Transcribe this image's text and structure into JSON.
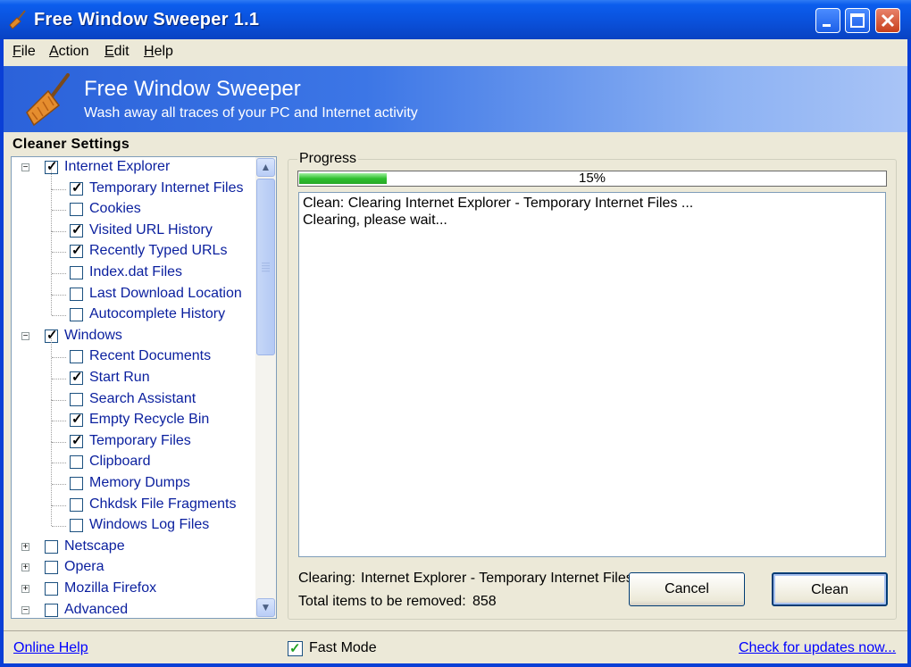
{
  "window": {
    "title": "Free Window Sweeper 1.1"
  },
  "menu": {
    "items": [
      {
        "key": "F",
        "rest": "ile"
      },
      {
        "key": "A",
        "rest": "ction"
      },
      {
        "key": "E",
        "rest": "dit"
      },
      {
        "key": "H",
        "rest": "elp"
      }
    ]
  },
  "banner": {
    "title": "Free Window Sweeper",
    "subtitle": "Wash away all traces of your PC and Internet activity"
  },
  "settings": {
    "label": "Cleaner Settings",
    "tree": [
      {
        "label": "Internet Explorer",
        "checked": true,
        "level": 0,
        "expander": "minus"
      },
      {
        "label": "Temporary Internet Files",
        "checked": true,
        "level": 1
      },
      {
        "label": "Cookies",
        "checked": false,
        "level": 1
      },
      {
        "label": "Visited URL History",
        "checked": true,
        "level": 1
      },
      {
        "label": "Recently Typed URLs",
        "checked": true,
        "level": 1
      },
      {
        "label": "Index.dat Files",
        "checked": false,
        "level": 1
      },
      {
        "label": "Last Download Location",
        "checked": false,
        "level": 1
      },
      {
        "label": "Autocomplete History",
        "checked": false,
        "level": 1
      },
      {
        "label": "Windows",
        "checked": true,
        "level": 0,
        "expander": "minus"
      },
      {
        "label": "Recent Documents",
        "checked": false,
        "level": 1
      },
      {
        "label": "Start Run",
        "checked": true,
        "level": 1
      },
      {
        "label": "Search Assistant",
        "checked": false,
        "level": 1
      },
      {
        "label": "Empty Recycle Bin",
        "checked": true,
        "level": 1
      },
      {
        "label": "Temporary Files",
        "checked": true,
        "level": 1
      },
      {
        "label": "Clipboard",
        "checked": false,
        "level": 1
      },
      {
        "label": "Memory Dumps",
        "checked": false,
        "level": 1
      },
      {
        "label": "Chkdsk File Fragments",
        "checked": false,
        "level": 1
      },
      {
        "label": "Windows Log Files",
        "checked": false,
        "level": 1
      },
      {
        "label": "Netscape",
        "checked": false,
        "level": 0,
        "expander": "plus"
      },
      {
        "label": "Opera",
        "checked": false,
        "level": 0,
        "expander": "plus"
      },
      {
        "label": "Mozilla Firefox",
        "checked": false,
        "level": 0,
        "expander": "plus"
      },
      {
        "label": "Advanced",
        "checked": false,
        "level": 0,
        "expander": "minus"
      }
    ]
  },
  "progress": {
    "label": "Progress",
    "percent": 15,
    "percent_text": "15%",
    "log": [
      "Clean: Clearing Internet Explorer - Temporary Internet Files ...",
      "Clearing, please wait..."
    ],
    "clearing_label": "Clearing:",
    "clearing_value": "Internet Explorer - Temporary Internet Files",
    "total_label": "Total items to be removed:",
    "total_value": "858"
  },
  "buttons": {
    "cancel": "Cancel",
    "clean": "Clean"
  },
  "footer": {
    "online_help": "Online Help",
    "fast_mode": "Fast Mode",
    "fast_mode_checked": true,
    "check_updates": "Check for updates now..."
  }
}
